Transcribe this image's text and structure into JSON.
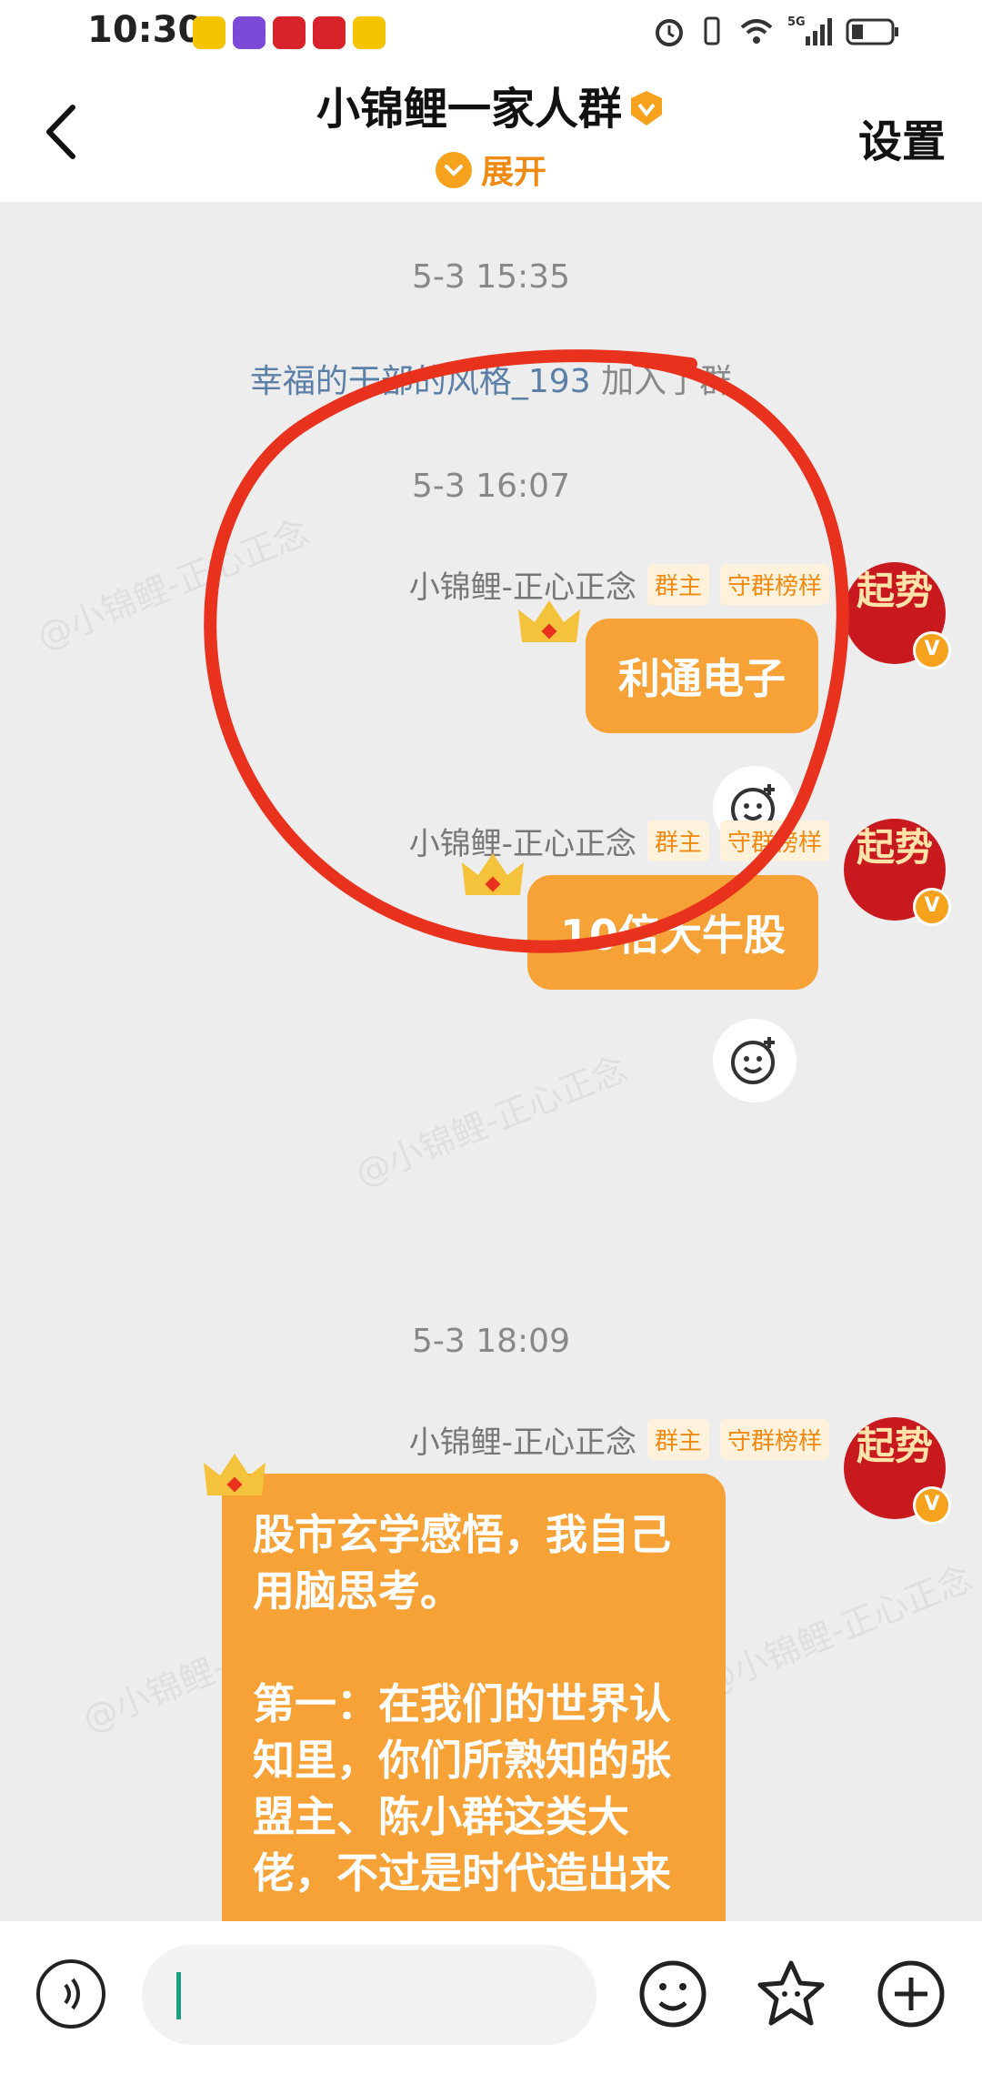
{
  "status_bar": {
    "time": "10:30",
    "network": "5G"
  },
  "header": {
    "title": "小锦鲤一家人群",
    "expand_label": "展开",
    "settings_label": "设置"
  },
  "chat": {
    "system": {
      "timestamp": "5-3 15:35",
      "user": "幸福的干部的风格_193",
      "action": " 加入了群"
    },
    "messages": [
      {
        "timestamp": "5-3 16:07",
        "sender": "小锦鲤-正心正念",
        "tag_owner": "群主",
        "tag_guard": "守群榜样",
        "text": "利通电子",
        "avatar_text": "起势"
      },
      {
        "timestamp": "",
        "sender": "小锦鲤-正心正念",
        "tag_owner": "群主",
        "tag_guard": "守群榜样",
        "text": "10倍大牛股",
        "avatar_text": "起势"
      },
      {
        "timestamp": "5-3 18:09",
        "sender": "小锦鲤-正心正念",
        "tag_owner": "群主",
        "tag_guard": "守群榜样",
        "text": "股市玄学感悟，我自己\n用脑思考。\n\n第一：在我们的世界认\n知里，你们所熟知的张\n盟主、陈小群这类大\n佬，不过是时代造出来",
        "avatar_text": "起势"
      }
    ],
    "watermark": "@小锦鲤-正心正念"
  },
  "colors": {
    "accent": "#f7a236",
    "brand_orange": "#f08a12",
    "annotation": "#e8321e"
  }
}
